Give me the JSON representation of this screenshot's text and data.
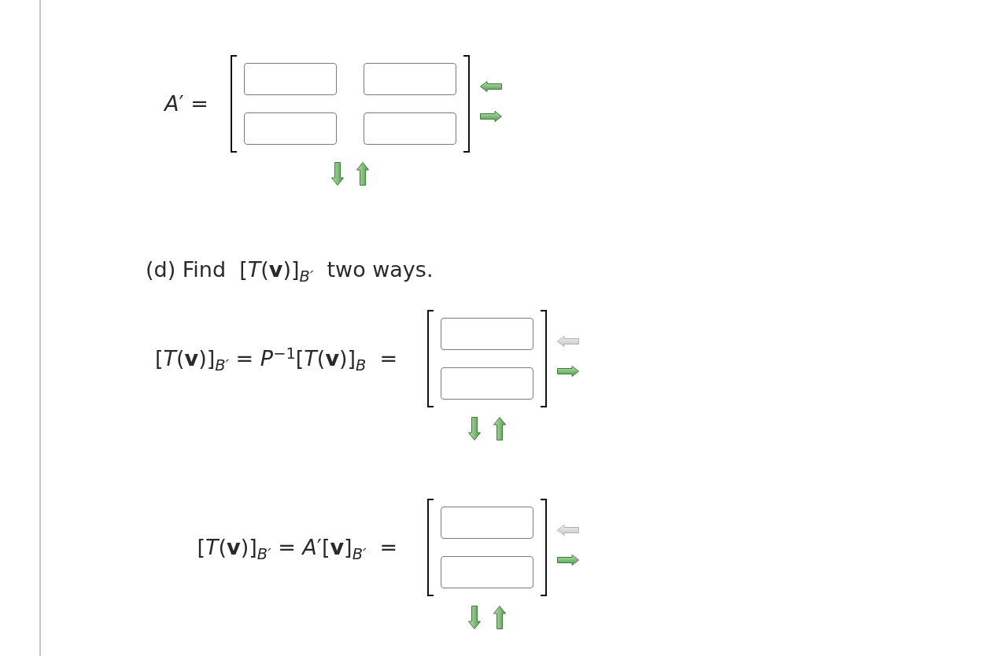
{
  "matrix_a_prime": {
    "label": "*A*′ =",
    "matrix": {
      "rows": [
        [
          {
            "kind": "input"
          },
          {
            "kind": "input"
          }
        ],
        [
          {
            "kind": "input"
          },
          {
            "kind": "input"
          }
        ]
      ],
      "column_controls": [
        {
          "kind": "left",
          "disabled": false
        },
        {
          "kind": "right",
          "disabled": false
        }
      ],
      "row_controls": [
        {
          "kind": "down",
          "disabled": false
        },
        {
          "kind": "up",
          "disabled": false
        }
      ]
    }
  },
  "part_d": {
    "heading": "(d) Find  [*T*(**v**)]$_{B′}$  two ways.",
    "equations": [
      {
        "label": "[*T*(**v**)]$_{B′}$ = *P*$^{−1}$[*T*(**v**)]$_{B}$  =",
        "matrix": {
          "rows": [
            [
              {
                "kind": "input"
              }
            ],
            [
              {
                "kind": "input"
              }
            ]
          ],
          "column_controls": [
            {
              "kind": "left",
              "disabled": true
            },
            {
              "kind": "right",
              "disabled": false
            }
          ],
          "row_controls": [
            {
              "kind": "down",
              "disabled": false
            },
            {
              "kind": "up",
              "disabled": false
            }
          ]
        }
      },
      {
        "label": "[*T*(**v**)]$_{B′}$ = *A*′[**v**]$_{B′}$  =",
        "matrix": {
          "rows": [
            [
              {
                "kind": "input"
              }
            ],
            [
              {
                "kind": "input"
              }
            ]
          ],
          "column_controls": [
            {
              "kind": "left",
              "disabled": true
            },
            {
              "kind": "right",
              "disabled": false
            }
          ],
          "row_controls": [
            {
              "kind": "down",
              "disabled": false
            },
            {
              "kind": "up",
              "disabled": false
            }
          ]
        }
      }
    ]
  }
}
